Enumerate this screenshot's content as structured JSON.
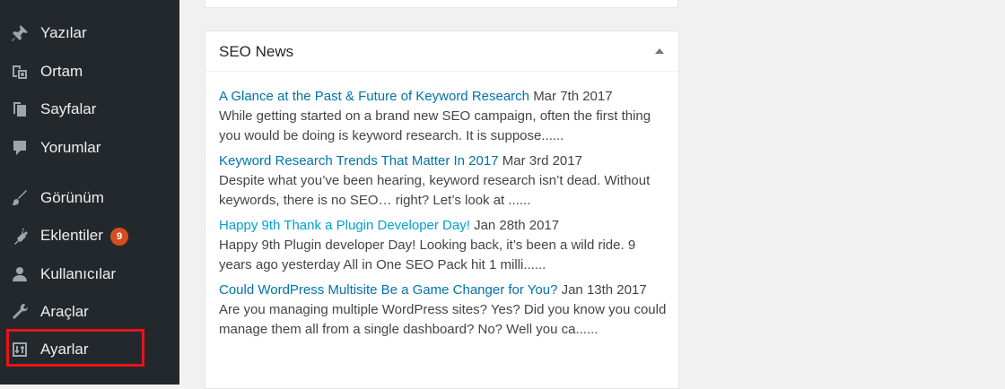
{
  "sidebar": {
    "items": [
      {
        "label": "Yazılar",
        "icon": "pin-icon"
      },
      {
        "label": "Ortam",
        "icon": "media-icon"
      },
      {
        "label": "Sayfalar",
        "icon": "pages-icon"
      },
      {
        "label": "Yorumlar",
        "icon": "comment-icon"
      },
      {
        "label": "Görünüm",
        "icon": "brush-icon"
      },
      {
        "label": "Eklentiler",
        "icon": "plugin-icon",
        "badge": "9"
      },
      {
        "label": "Kullanıcılar",
        "icon": "user-icon"
      },
      {
        "label": "Araçlar",
        "icon": "wrench-icon"
      },
      {
        "label": "Ayarlar",
        "icon": "settings-icon"
      }
    ],
    "highlighted_item": "Ayarlar"
  },
  "widget": {
    "title": "SEO News",
    "news": [
      {
        "title": "A Glance at the Past & Future of Keyword Research",
        "date": "Mar 7th 2017",
        "excerpt": "While getting started on a brand new SEO campaign, often the first thing you would be doing is keyword research. It is suppose......"
      },
      {
        "title": "Keyword Research Trends That Matter In 2017",
        "date": "Mar 3rd 2017",
        "excerpt": "Despite what you’ve been hearing, keyword research isn’t dead. Without keywords, there is no SEO… right? Let’s look at ......"
      },
      {
        "title": "Happy 9th Thank a Plugin Developer Day!",
        "date": "Jan 28th 2017",
        "excerpt": "Happy 9th Plugin developer Day! Looking back, it’s been a wild ride. 9 years ago yesterday All in One SEO Pack hit 1 milli......"
      },
      {
        "title": "Could WordPress Multisite Be a Game Changer for You?",
        "date": "Jan 13th 2017",
        "excerpt": "Are you managing multiple WordPress sites? Yes? Did you know you could manage them all from a single dashboard? No? Well you ca......"
      }
    ]
  },
  "colors": {
    "sidebar_bg": "#23282d",
    "link": "#0073aa",
    "link_hover": "#00a0d2",
    "badge": "#d54e21",
    "highlight": "#e8141a"
  }
}
